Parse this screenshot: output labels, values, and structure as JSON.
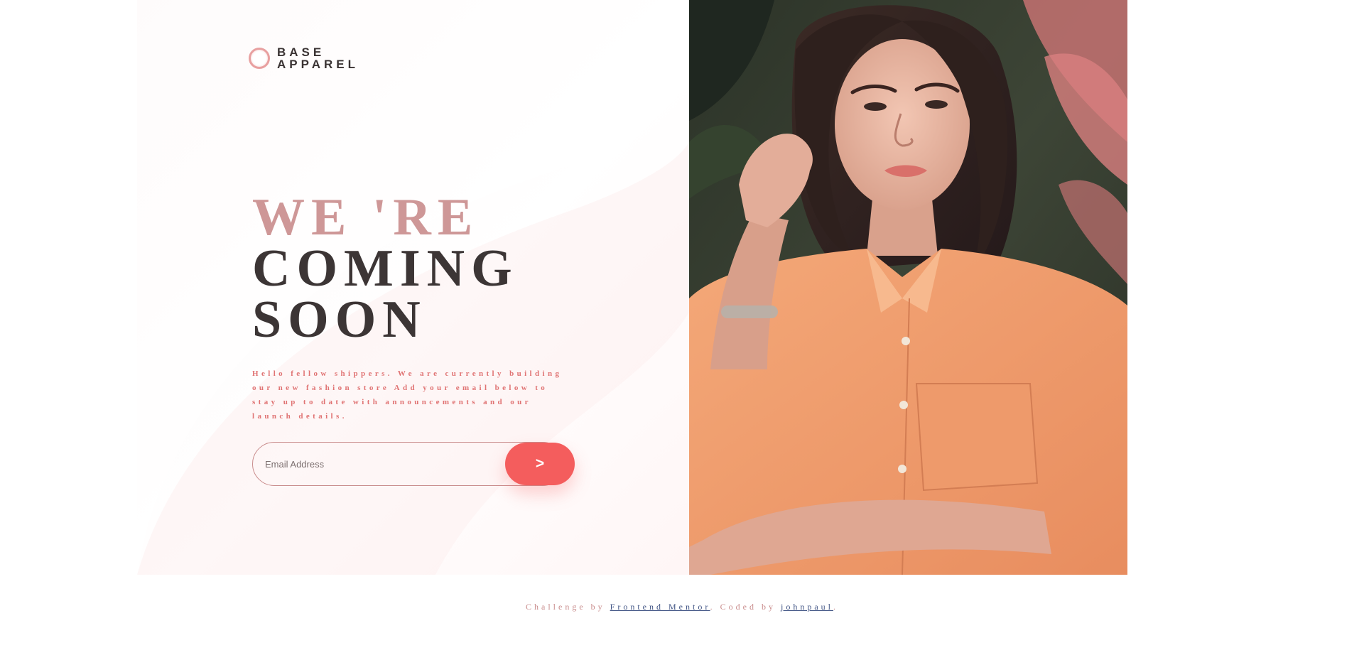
{
  "brand": {
    "line1": "BASE",
    "line2": "APPAREL"
  },
  "headline": {
    "light": "WE 'RE",
    "dark1": "COMING",
    "dark2": "SOON"
  },
  "description": "Hello fellow shippers. We are currently building our new fashion store Add your email below to stay up to date with announcements and our launch details.",
  "form": {
    "email_placeholder": "Email Address",
    "submit_label": ">"
  },
  "footer": {
    "prefix": "Challenge by ",
    "link1": "Frontend Mentor",
    "middle": ". Coded by ",
    "link2": "johnpaul",
    "suffix": "."
  },
  "colors": {
    "accent": "#f45d5d",
    "headline_light": "#ce9797",
    "headline_dark": "#3c3535",
    "body_text": "#e07373",
    "link": "#3e5283"
  },
  "hero_image": {
    "subject": "woman in orange shirt portrait"
  }
}
